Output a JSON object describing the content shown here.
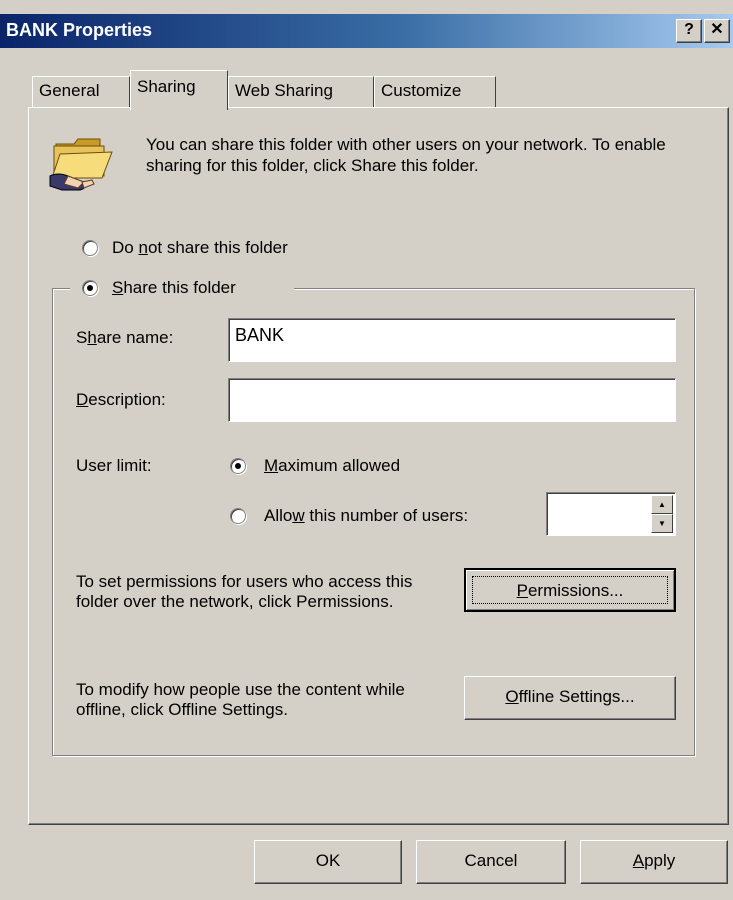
{
  "window": {
    "title": "BANK Properties",
    "help_label": "?",
    "close_label": "✕"
  },
  "tabs": [
    {
      "label": "General",
      "active": false
    },
    {
      "label": "Sharing",
      "active": true
    },
    {
      "label": "Web Sharing",
      "active": false
    },
    {
      "label": "Customize",
      "active": false
    }
  ],
  "sharing": {
    "intro": "You can share this folder with other users on your network.  To enable sharing for this folder, click Share this folder.",
    "do_not_share": {
      "pre": "Do ",
      "accel": "n",
      "post": "ot share this folder",
      "selected": false
    },
    "share": {
      "pre": "",
      "accel": "S",
      "post": "hare this folder",
      "selected": true
    },
    "share_name": {
      "label_pre": "S",
      "label_accel": "h",
      "label_post": "are name:",
      "value": "BANK"
    },
    "description": {
      "label_pre": "",
      "label_accel": "D",
      "label_post": "escription:",
      "value": ""
    },
    "user_limit_label": "User limit:",
    "max_allowed": {
      "pre": "",
      "accel": "M",
      "post": "aximum allowed",
      "selected": true
    },
    "allow_number": {
      "pre": "Allo",
      "accel": "w",
      "post": " this number of users:",
      "selected": false,
      "value": ""
    },
    "permissions_text": "To set permissions for users who access this folder over the network, click Permissions.",
    "permissions_button": {
      "pre": "",
      "accel": "P",
      "post": "ermissions..."
    },
    "offline_text": "To modify how people use the content while offline, click Offline Settings.",
    "offline_button": {
      "pre": "",
      "accel": "O",
      "post": "ffline Settings..."
    }
  },
  "footer": {
    "ok_label": "OK",
    "cancel_label": "Cancel",
    "apply": {
      "pre": "",
      "accel": "A",
      "post": "pply"
    }
  },
  "colors": {
    "title_start": "#0a246a",
    "title_end": "#a6caf0",
    "face": "#d4d0c8"
  }
}
